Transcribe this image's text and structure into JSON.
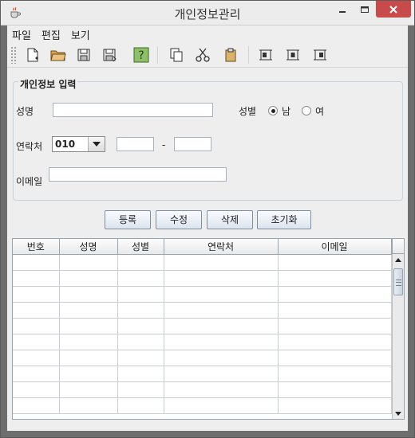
{
  "window": {
    "title": "개인정보관리"
  },
  "menu": [
    "파일",
    "편집",
    "보기"
  ],
  "toolbar": {
    "icons": [
      "new-file-icon",
      "open-folder-icon",
      "save-icon",
      "save-as-icon",
      "help-icon",
      "copy-icon",
      "cut-icon",
      "paste-icon",
      "align-left-icon",
      "align-center-icon",
      "align-right-icon"
    ]
  },
  "form": {
    "group_title": "개인정보 입력",
    "name_label": "성명",
    "name_value": "",
    "gender_label": "성별",
    "gender_options": [
      "남",
      "여"
    ],
    "gender_selected": "남",
    "contact_label": "연락처",
    "contact_prefix": "010",
    "contact_dash": "-",
    "contact_mid": "",
    "contact_last": "",
    "email_label": "이메일",
    "email_value": ""
  },
  "buttons": [
    "등록",
    "수정",
    "삭제",
    "초기화"
  ],
  "table": {
    "columns": [
      "번호",
      "성명",
      "성별",
      "연락처",
      "이메일"
    ],
    "rows": []
  },
  "colors": {
    "close_button": "#c74b4b",
    "accent_border": "#7d8fa4"
  }
}
